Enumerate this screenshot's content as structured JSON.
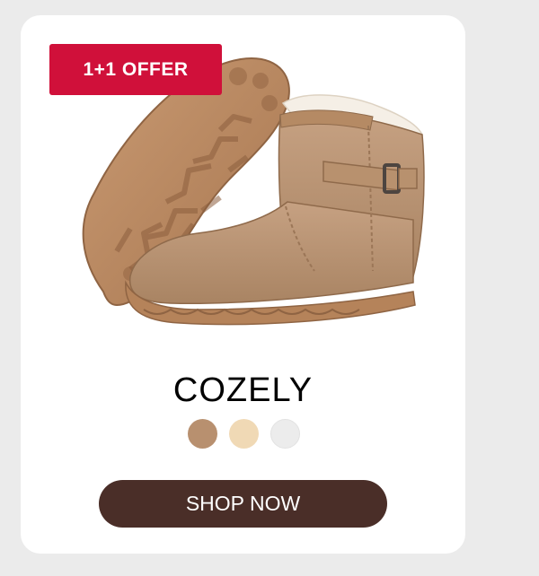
{
  "badge": {
    "label": "1+1 OFFER",
    "color": "#d0103a"
  },
  "product": {
    "name": "COZELY",
    "image_icon": "suede-snow-boot-image",
    "swatches": [
      {
        "name": "brown",
        "color": "#b8906f"
      },
      {
        "name": "beige",
        "color": "#f0d9b5"
      },
      {
        "name": "white",
        "color": "#ececec"
      }
    ]
  },
  "cta": {
    "label": "SHOP NOW",
    "color": "#4a2e28"
  }
}
